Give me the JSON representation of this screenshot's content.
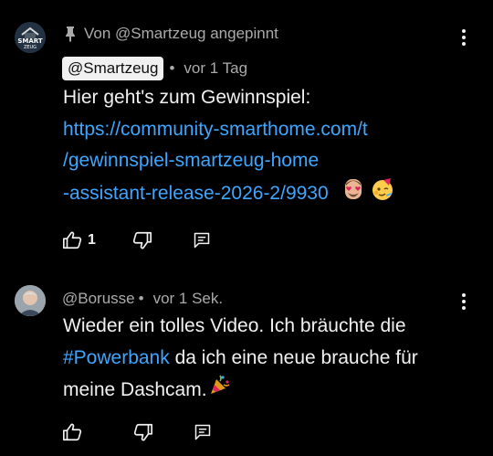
{
  "comments": [
    {
      "pinned_label": "Von @Smartzeug angepinnt",
      "author": "@Smartzeug",
      "separator": "•",
      "time": "vor 1 Tag",
      "text_lines": [
        "Hier geht's zum Gewinnspiel:"
      ],
      "link_lines": [
        "https://community-smarthome.com/t",
        "/gewinnspiel-smartzeug-home",
        "-assistant-release-2026-2/9930"
      ],
      "like_count": "1",
      "avatar_text": [
        "SMART",
        "ZEUG"
      ]
    },
    {
      "author": "@Borusse",
      "separator": "•",
      "time": "vor 1 Sek.",
      "line1": "Wieder ein tolles Video. Ich bräuchte die",
      "hashtag": "#Powerbank",
      "line2_rest": " da ich eine neue brauche für",
      "line3": "meine Dashcam."
    }
  ],
  "colors": {
    "background": "#000000",
    "text": "#f1f1f1",
    "secondary": "#aaaaaa",
    "link": "#3ea6ff"
  },
  "icons": [
    "pin-icon",
    "more-vert-icon",
    "thumb-up-icon",
    "thumb-down-icon",
    "reply-icon",
    "emoji-heart-eyes-face",
    "emoji-partying-face",
    "emoji-party-popper"
  ]
}
